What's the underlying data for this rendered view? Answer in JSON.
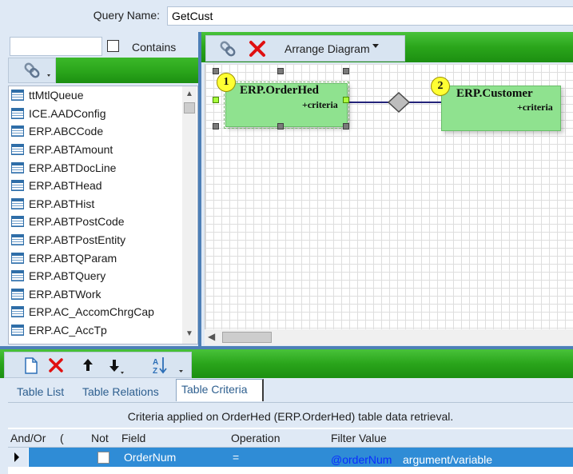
{
  "query": {
    "label": "Query Name:",
    "value": "GetCust"
  },
  "left": {
    "search_value": "",
    "contains_label": "Contains",
    "contains_checked": false,
    "tables": [
      "ttMtlQueue",
      "ICE.AADConfig",
      "ERP.ABCCode",
      "ERP.ABTAmount",
      "ERP.ABTDocLine",
      "ERP.ABTHead",
      "ERP.ABTHist",
      "ERP.ABTPostCode",
      "ERP.ABTPostEntity",
      "ERP.ABTQParam",
      "ERP.ABTQuery",
      "ERP.ABTWork",
      "ERP.AC_AccomChrgCap",
      "ERP.AC_AccTp"
    ]
  },
  "diagram": {
    "toolbar": {
      "arrange_label": "Arrange Diagram"
    },
    "tables": [
      {
        "num": "1",
        "name": "ERP.OrderHed",
        "criteria": "+criteria"
      },
      {
        "num": "2",
        "name": "ERP.Customer",
        "criteria": "+criteria"
      }
    ]
  },
  "bottom": {
    "tabs": [
      "Table List",
      "Table Relations",
      "Table Criteria"
    ],
    "active_tab": "Table Criteria",
    "criteria_info": "Criteria applied on OrderHed (ERP.OrderHed)  table data retrieval.",
    "columns": {
      "and_or": "And/Or",
      "paren": "(",
      "not": "Not",
      "field": "Field",
      "operation": "Operation",
      "filter_value": "Filter Value"
    },
    "row": {
      "not_checked": false,
      "field": "OrderNum",
      "operation": "=",
      "value_var": "@orderNum",
      "value_type": "argument/variable"
    }
  },
  "colors": {
    "toolbar_green": "#2aa51b",
    "panel": "#dfe9f5",
    "selection": "#2f8cd6",
    "table_box": "#8fe28f",
    "badge": "#ffff33"
  }
}
